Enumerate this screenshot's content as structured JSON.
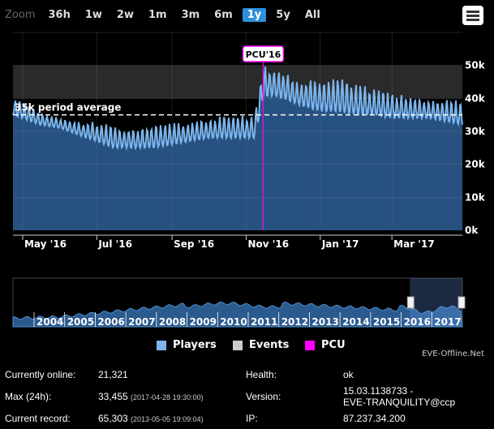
{
  "range_selector": {
    "zoom_label": "Zoom",
    "buttons": [
      "36h",
      "1w",
      "2w",
      "1m",
      "3m",
      "6m",
      "1y",
      "5y",
      "All"
    ],
    "active": "1y"
  },
  "main_chart": {
    "x_labels": [
      "May '16",
      "Jul '16",
      "Sep '16",
      "Nov '16",
      "Jan '17",
      "Mar '17"
    ],
    "y_labels": [
      "0k",
      "10k",
      "20k",
      "30k",
      "40k",
      "50k"
    ],
    "avg_label": "35k period average",
    "avg_value": 35,
    "pcu_label": "PCU'16",
    "band_low": 40,
    "band_high": 50
  },
  "chart_data": {
    "type": "line",
    "unit": "k",
    "y_range": [
      0,
      50
    ],
    "series": [
      {
        "name": "Players",
        "color": "#7cb5ec",
        "x": [
          "2016-04-23",
          "2016-05-15",
          "2016-06-01",
          "2016-06-15",
          "2016-07-01",
          "2016-07-15",
          "2016-08-01",
          "2016-08-15",
          "2016-09-01",
          "2016-09-15",
          "2016-10-01",
          "2016-10-15",
          "2016-11-01",
          "2016-11-08",
          "2016-11-15",
          "2016-11-20",
          "2016-12-01",
          "2016-12-15",
          "2017-01-01",
          "2017-01-15",
          "2017-02-01",
          "2017-02-15",
          "2017-03-01",
          "2017-03-15",
          "2017-04-01",
          "2017-04-15",
          "2017-04-28"
        ],
        "min": [
          35,
          32,
          31,
          29,
          27,
          25,
          25,
          25,
          26,
          27,
          28,
          28,
          28,
          28,
          40,
          41,
          40,
          38,
          36,
          36,
          35,
          35,
          34,
          34,
          34,
          33,
          32
        ],
        "max": [
          41,
          36,
          34,
          33,
          33,
          32,
          31,
          32,
          33,
          33,
          34,
          35,
          35,
          35,
          51,
          50,
          49,
          45,
          47,
          47,
          45,
          43,
          42,
          41,
          40,
          40,
          39
        ]
      }
    ],
    "reference_line": {
      "label": "35k period average",
      "value": 35
    },
    "pcu_marker": {
      "label": "PCU'16",
      "date": "2016-11-15"
    }
  },
  "navigator": {
    "years": [
      "2004",
      "2005",
      "2006",
      "2007",
      "2008",
      "2009",
      "2010",
      "2011",
      "2012",
      "2013",
      "2014",
      "2015",
      "2016",
      "2017"
    ]
  },
  "legend": [
    {
      "label": "Players",
      "color": "#7cb5ec"
    },
    {
      "label": "Events",
      "color": "#cccccc"
    },
    {
      "label": "PCU",
      "color": "#ff00ff"
    }
  ],
  "credit": "EVE-Offline.Net",
  "info": {
    "currently_online_label": "Currently online:",
    "currently_online_value": "21,321",
    "max_label": "Max (24h):",
    "max_value": "33,455",
    "max_time": "(2017-04-28 19:30:00)",
    "record_label": "Current record:",
    "record_value": "65,303",
    "record_time": "(2013-05-05 19:09:04)",
    "health_label": "Health:",
    "health_value": "ok",
    "version_label": "Version:",
    "version_value_1": "15.03.1138733 -",
    "version_value_2": "EVE-TRANQUILITY@ccp",
    "ip_label": "IP:",
    "ip_value": "87.237.34.200"
  }
}
